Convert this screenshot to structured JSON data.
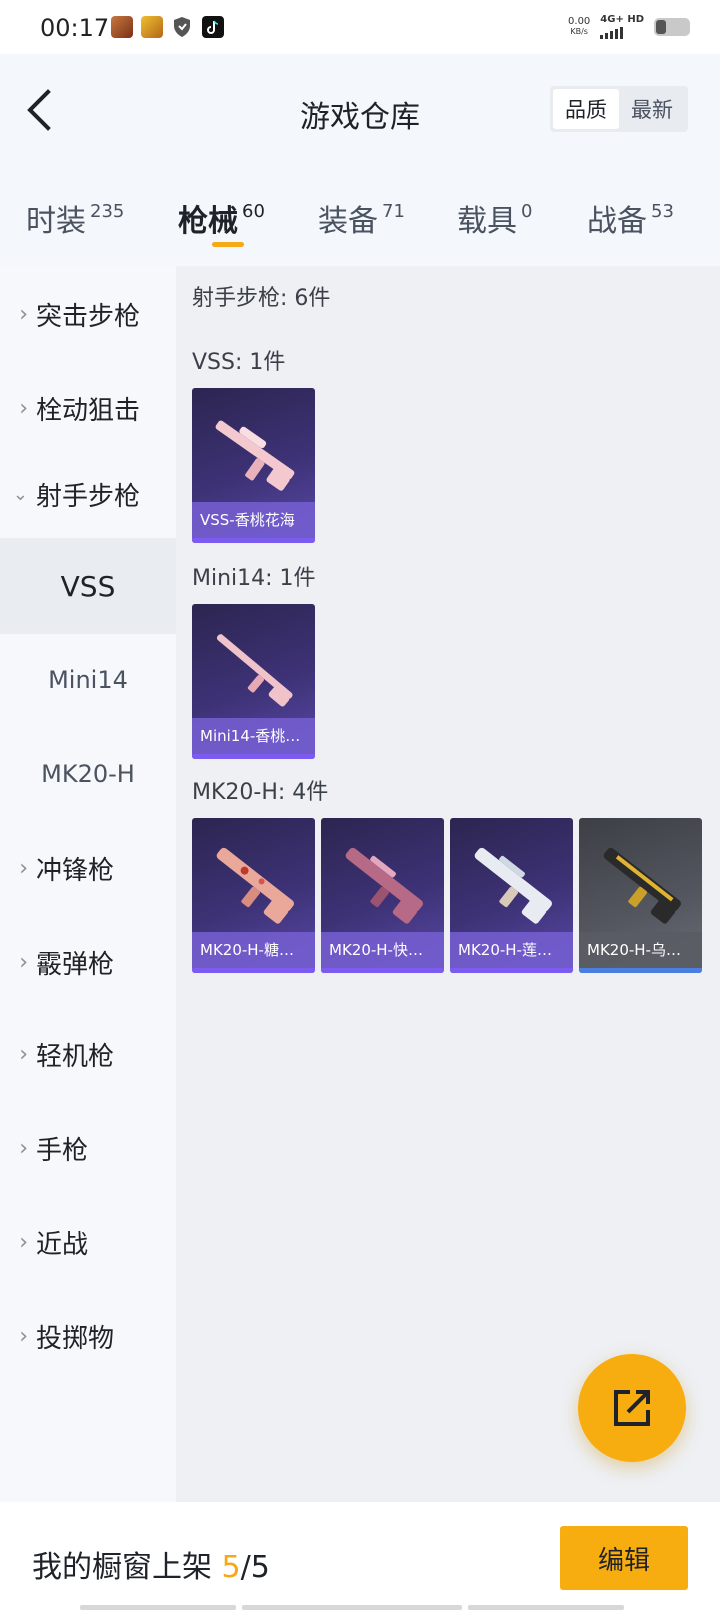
{
  "status_bar": {
    "time": "00:17",
    "net_speed": "0.00",
    "net_unit": "KB/s",
    "net_type": "4G+ HD",
    "app_icons": [
      "game-app-icon",
      "game-app-icon-2",
      "shield-icon",
      "tiktok-icon"
    ]
  },
  "header": {
    "title": "游戏仓库",
    "sort_options": [
      "品质",
      "最新"
    ],
    "active_sort": "品质"
  },
  "tabs": [
    {
      "label": "时装",
      "count": "235"
    },
    {
      "label": "枪械",
      "count": "60"
    },
    {
      "label": "装备",
      "count": "71"
    },
    {
      "label": "载具",
      "count": "0"
    },
    {
      "label": "战备",
      "count": "53"
    }
  ],
  "active_tab": "枪械",
  "sidebar": {
    "categories": [
      {
        "label": "突击步枪",
        "expanded": false
      },
      {
        "label": "栓动狙击",
        "expanded": false
      },
      {
        "label": "射手步枪",
        "expanded": true
      },
      {
        "label": "冲锋枪",
        "expanded": false
      },
      {
        "label": "霰弹枪",
        "expanded": false
      },
      {
        "label": "轻机枪",
        "expanded": false
      },
      {
        "label": "手枪",
        "expanded": false
      },
      {
        "label": "近战",
        "expanded": false
      },
      {
        "label": "投掷物",
        "expanded": false
      }
    ],
    "subitems": [
      "VSS",
      "Mini14",
      "MK20-H"
    ],
    "active_subitem": "VSS"
  },
  "content": {
    "section_title": "射手步枪: 6件",
    "groups": [
      {
        "title": "VSS: 1件",
        "items": [
          {
            "name": "VSS-香桃花海",
            "rarity": "purple"
          }
        ]
      },
      {
        "title": "Mini14: 1件",
        "items": [
          {
            "name": "Mini14-香桃…",
            "rarity": "purple"
          }
        ]
      },
      {
        "title": "MK20-H: 4件",
        "items": [
          {
            "name": "MK20-H-糖…",
            "rarity": "purple"
          },
          {
            "name": "MK20-H-快…",
            "rarity": "purple"
          },
          {
            "name": "MK20-H-莲…",
            "rarity": "purple"
          },
          {
            "name": "MK20-H-乌…",
            "rarity": "blue"
          }
        ]
      }
    ]
  },
  "fab": {
    "icon": "share-external-icon"
  },
  "bottom_bar": {
    "showcase_label": "我的橱窗上架",
    "showcase_count": "5",
    "showcase_total": "/5",
    "edit_label": "编辑"
  },
  "colors": {
    "accent": "#f7ad10",
    "card_purple": "#3e3277",
    "card_blue_edge": "#4a7ee0",
    "page_bg": "#eef0f4"
  }
}
